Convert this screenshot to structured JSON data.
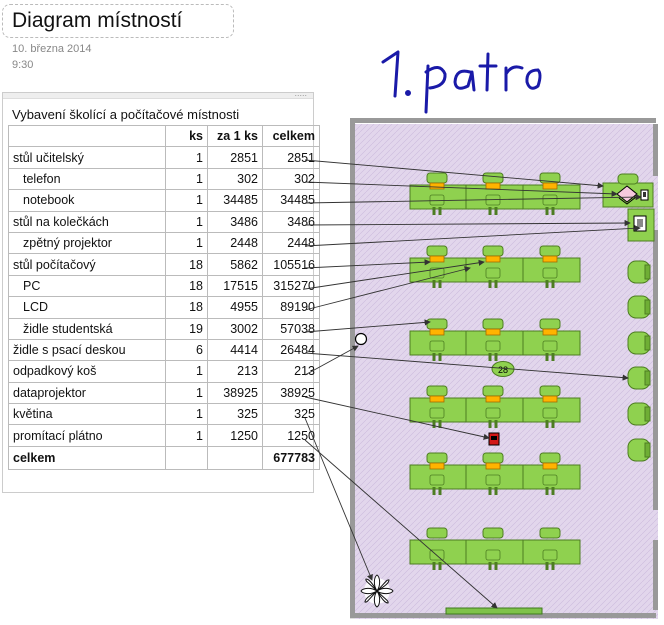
{
  "page": {
    "title": "Diagram místností",
    "date": "10. března 2014",
    "time": "9:30"
  },
  "handwriting": "1. patro",
  "table": {
    "caption": "Vybavení školící a počítačové místnosti",
    "headers": [
      "",
      "ks",
      "za 1 ks",
      "celkem"
    ],
    "rows": [
      {
        "name": "stůl učitelský",
        "sub": false,
        "ks": "1",
        "unit": "2851",
        "total": "2851"
      },
      {
        "name": "telefon",
        "sub": true,
        "ks": "1",
        "unit": "302",
        "total": "302"
      },
      {
        "name": "notebook",
        "sub": true,
        "ks": "1",
        "unit": "34485",
        "total": "34485"
      },
      {
        "name": "stůl na kolečkách",
        "sub": false,
        "ks": "1",
        "unit": "3486",
        "total": "3486"
      },
      {
        "name": "zpětný projektor",
        "sub": true,
        "ks": "1",
        "unit": "2448",
        "total": "2448"
      },
      {
        "name": "stůl počítačový",
        "sub": false,
        "ks": "18",
        "unit": "5862",
        "total": "105516"
      },
      {
        "name": "PC",
        "sub": true,
        "ks": "18",
        "unit": "17515",
        "total": "315270"
      },
      {
        "name": "LCD",
        "sub": true,
        "ks": "18",
        "unit": "4955",
        "total": "89190"
      },
      {
        "name": "židle studentská",
        "sub": true,
        "ks": "19",
        "unit": "3002",
        "total": "57038"
      },
      {
        "name": "židle s psací deskou",
        "sub": false,
        "ks": "6",
        "unit": "4414",
        "total": "26484"
      },
      {
        "name": "odpadkový  koš",
        "sub": false,
        "ks": "1",
        "unit": "213",
        "total": "213"
      },
      {
        "name": "dataprojektor",
        "sub": false,
        "ks": "1",
        "unit": "38925",
        "total": "38925"
      },
      {
        "name": "květina",
        "sub": false,
        "ks": "1",
        "unit": "325",
        "total": "325"
      },
      {
        "name": "promítací  plátno",
        "sub": false,
        "ks": "1",
        "unit": "1250",
        "total": "1250"
      }
    ],
    "total_label": "celkem",
    "total_value": "677783"
  },
  "room_label": "28",
  "colors": {
    "floor": "#e2d6ec",
    "desk": "#8fd14f",
    "chair": "#8fd14f",
    "monitor": "#ffb300",
    "projector": "#cc1111",
    "handwriting": "#1a1aa8"
  }
}
